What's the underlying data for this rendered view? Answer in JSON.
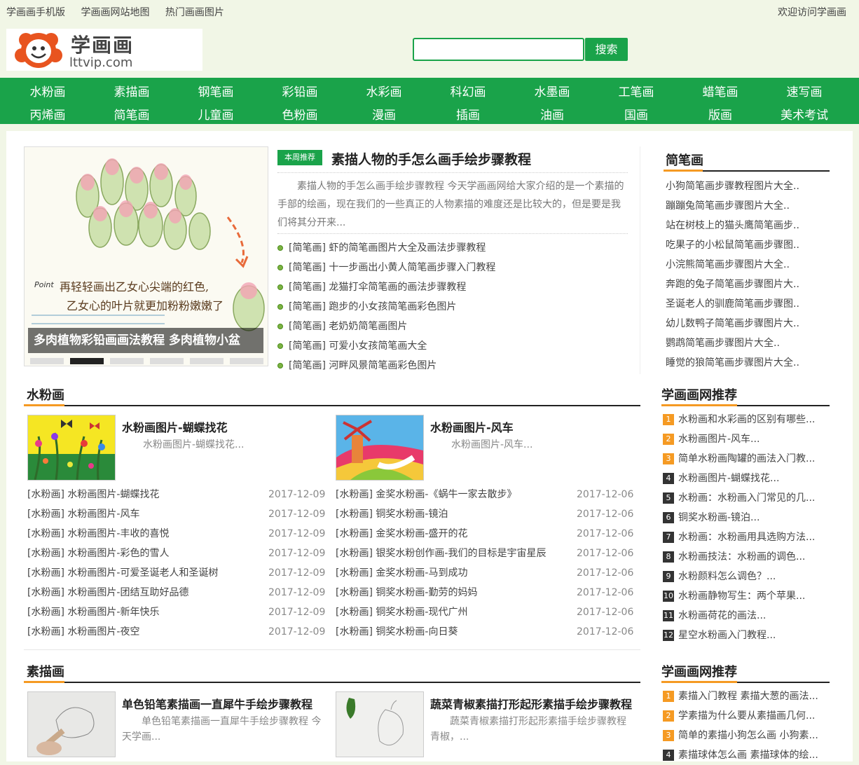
{
  "topbar": {
    "links": [
      "学画画手机版",
      "学画画网站地图",
      "热门画画图片"
    ],
    "welcome": "欢迎访问学画画"
  },
  "logo": {
    "brand": "学画画",
    "domain": "lttvip.com"
  },
  "search": {
    "placeholder": "",
    "button": "搜索"
  },
  "nav": {
    "row1": [
      "水粉画",
      "素描画",
      "钢笔画",
      "彩铅画",
      "水彩画",
      "科幻画",
      "水墨画",
      "工笔画",
      "蜡笔画",
      "速写画"
    ],
    "row2": [
      "丙烯画",
      "简笔画",
      "儿童画",
      "色粉画",
      "漫画",
      "插画",
      "油画",
      "国画",
      "版画",
      "美术考试"
    ]
  },
  "slideshow": {
    "caption": "多肉植物彩铅画画法教程 多肉植物小盆",
    "image_text_1": "再轻轻画出乙女心尖端的红色,",
    "image_text_2": "乙女心的叶片就更加粉粉嫩嫩了",
    "image_point": "Point",
    "active_dot": 1,
    "dot_count": 6
  },
  "featured": {
    "tag": "本周推荐",
    "title": "素描人物的手怎么画手绘步骤教程",
    "desc": "素描人物的手怎么画手绘步骤教程 今天学画画网给大家介绍的是一个素描的手部的绘画，现在我们的一些真正的人物素描的难度还是比较大的，但是要是我们将其分开来...",
    "list": [
      {
        "cat": "[简笔画]",
        "title": "虾的简笔画图片大全及画法步骤教程"
      },
      {
        "cat": "[简笔画]",
        "title": "十一步画出小黄人简笔画步骤入门教程"
      },
      {
        "cat": "[简笔画]",
        "title": "龙猫打伞简笔画的画法步骤教程"
      },
      {
        "cat": "[简笔画]",
        "title": "跑步的小女孩简笔画彩色图片"
      },
      {
        "cat": "[简笔画]",
        "title": "老奶奶简笔画图片"
      },
      {
        "cat": "[简笔画]",
        "title": "可爱小女孩简笔画大全"
      },
      {
        "cat": "[简笔画]",
        "title": "河畔风景简笔画彩色图片"
      }
    ]
  },
  "sidebar_jianbihua": {
    "title": "简笔画",
    "items": [
      "小狗简笔画步骤教程图片大全..",
      "蹦蹦兔简笔画步骤图片大全..",
      "站在树枝上的猫头鹰简笔画步..",
      "吃果子的小松鼠简笔画步骤图..",
      "小浣熊简笔画步骤图片大全..",
      "奔跑的兔子简笔画步骤图片大..",
      "圣诞老人的驯鹿简笔画步骤图..",
      "幼儿数鸭子简笔画步骤图片大..",
      "鹦鹉简笔画步骤图片大全..",
      "睡觉的狼简笔画步骤图片大全.."
    ]
  },
  "shuifen": {
    "title": "水粉画",
    "cards": [
      {
        "title": "水粉画图片-蝴蝶找花",
        "desc": "水粉画图片-蝴蝶找花..."
      },
      {
        "title": "水粉画图片-风车",
        "desc": "水粉画图片-风车..."
      }
    ],
    "left": [
      {
        "cat": "[水粉画]",
        "title": "水粉画图片-蝴蝶找花",
        "date": "2017-12-09"
      },
      {
        "cat": "[水粉画]",
        "title": "水粉画图片-风车",
        "date": "2017-12-09"
      },
      {
        "cat": "[水粉画]",
        "title": "水粉画图片-丰收的喜悦",
        "date": "2017-12-09"
      },
      {
        "cat": "[水粉画]",
        "title": "水粉画图片-彩色的雪人",
        "date": "2017-12-09"
      },
      {
        "cat": "[水粉画]",
        "title": "水粉画图片-可爱圣诞老人和圣诞树",
        "date": "2017-12-09"
      },
      {
        "cat": "[水粉画]",
        "title": "水粉画图片-团结互助好品德",
        "date": "2017-12-09"
      },
      {
        "cat": "[水粉画]",
        "title": "水粉画图片-新年快乐",
        "date": "2017-12-09"
      },
      {
        "cat": "[水粉画]",
        "title": "水粉画图片-夜空",
        "date": "2017-12-09"
      }
    ],
    "right": [
      {
        "cat": "[水粉画]",
        "title": "金奖水粉画-《蜗牛一家去散步》",
        "date": "2017-12-06"
      },
      {
        "cat": "[水粉画]",
        "title": "铜奖水粉画-镜泊",
        "date": "2017-12-06"
      },
      {
        "cat": "[水粉画]",
        "title": "金奖水粉画-盛开的花",
        "date": "2017-12-06"
      },
      {
        "cat": "[水粉画]",
        "title": "银奖水粉创作画-我们的目标是宇宙星辰",
        "date": "2017-12-06"
      },
      {
        "cat": "[水粉画]",
        "title": "金奖水粉画-马到成功",
        "date": "2017-12-06"
      },
      {
        "cat": "[水粉画]",
        "title": "铜奖水粉画-勤劳的妈妈",
        "date": "2017-12-06"
      },
      {
        "cat": "[水粉画]",
        "title": "铜奖水粉画-现代广州",
        "date": "2017-12-06"
      },
      {
        "cat": "[水粉画]",
        "title": "铜奖水粉画-向日葵",
        "date": "2017-12-06"
      }
    ]
  },
  "recommend1": {
    "title": "学画画网推荐",
    "items": [
      "水粉画和水彩画的区别有哪些...",
      "水粉画图片-风车...",
      "简单水粉画陶罐的画法入门教...",
      "水粉画图片-蝴蝶找花...",
      "水粉画：水粉画入门常见的几...",
      "铜奖水粉画-镜泊...",
      "水粉画：水粉画用具选购方法...",
      "水粉画技法：水粉画的调色...",
      "水粉颜料怎么调色？...",
      "水粉画静物写生：两个苹果...",
      "水粉画荷花的画法...",
      "星空水粉画入门教程..."
    ]
  },
  "sumiao": {
    "title": "素描画",
    "cards": [
      {
        "title": "单色铅笔素描画一直犀牛手绘步骤教程",
        "desc": "单色铅笔素描画一直犀牛手绘步骤教程 今天学画..."
      },
      {
        "title": "蔬菜青椒素描打形起形素描手绘步骤教程",
        "desc": "蔬菜青椒素描打形起形素描手绘步骤教程 青椒，..."
      }
    ]
  },
  "recommend2": {
    "title": "学画画网推荐",
    "items": [
      "素描入门教程 素描大葱的画法...",
      "学素描为什么要从素描画几何...",
      "简单的素描小狗怎么画 小狗素...",
      "素描球体怎么画 素描球体的绘..."
    ]
  },
  "colors": {
    "green": "#1aa34a",
    "orange": "#f59a23",
    "page_bg": "#f1f6e6"
  }
}
